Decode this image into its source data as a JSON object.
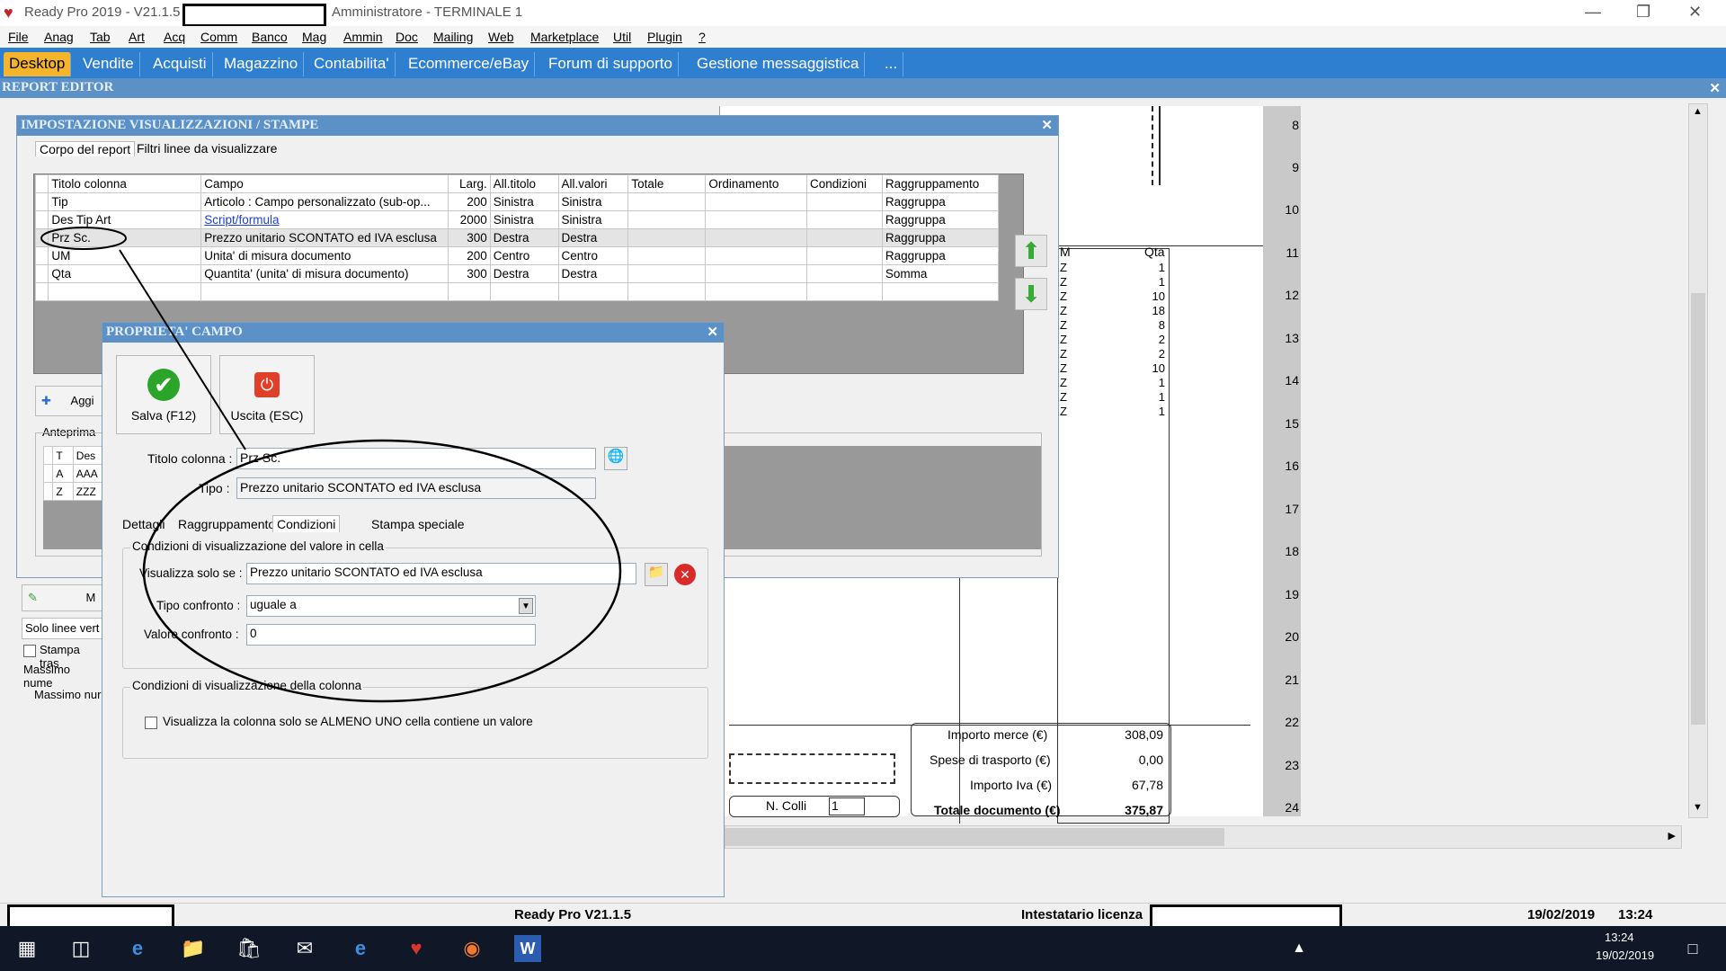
{
  "window": {
    "app_title": "Ready Pro 2019 - V21.1.5",
    "user_title": "Amministratore - TERMINALE 1"
  },
  "menu": [
    "File",
    "Anag",
    "Tab",
    "Art",
    "Acq",
    "Comm",
    "Banco",
    "Mag",
    "Ammin",
    "Doc",
    "Mailing",
    "Web",
    "Marketplace",
    "Util",
    "Plugin",
    "?"
  ],
  "tabs": [
    "Desktop",
    "Vendite",
    "Acquisti",
    "Magazzino",
    "Contabilita'",
    "Ecommerce/eBay",
    "Forum di supporto",
    "Gestione messaggistica",
    "..."
  ],
  "report_editor": {
    "title": "REPORT EDITOR"
  },
  "imp_dialog": {
    "title": "IMPOSTAZIONE VISUALIZZAZIONI / STAMPE",
    "tabs": [
      "Corpo del report",
      "Filtri linee da visualizzare"
    ],
    "columns": [
      "Titolo colonna",
      "Campo",
      "Larg.",
      "All.titolo",
      "All.valori",
      "Totale",
      "Ordinamento",
      "Condizioni",
      "Raggruppamento"
    ],
    "rows": [
      [
        "Tip",
        "Articolo : Campo personalizzato (sub-op...",
        "200",
        "Sinistra",
        "Sinistra",
        "",
        "",
        "",
        "Raggruppa"
      ],
      [
        "Des Tip Art",
        "Script/formula",
        "2000",
        "Sinistra",
        "Sinistra",
        "",
        "",
        "",
        "Raggruppa"
      ],
      [
        "Prz Sc.",
        "Prezzo unitario SCONTATO ed IVA esclusa",
        "300",
        "Destra",
        "Destra",
        "",
        "",
        "",
        "Raggruppa"
      ],
      [
        "UM",
        "Unita' di misura documento",
        "200",
        "Centro",
        "Centro",
        "",
        "",
        "",
        "Raggruppa"
      ],
      [
        "Qta",
        "Quantita' (unita' di misura documento)",
        "300",
        "Destra",
        "Destra",
        "",
        "",
        "",
        "Somma"
      ]
    ],
    "add_label": "Aggi",
    "preview_label": "Anteprima",
    "preview_rows": [
      [
        "T",
        "Des"
      ],
      [
        "A",
        "AAA"
      ],
      [
        "Z",
        "ZZZ"
      ]
    ],
    "side_labels": [
      "Solo linee vert",
      "Stampa tras",
      "Massimo nume",
      "Massimo nur"
    ],
    "side_button": "M"
  },
  "prop_dialog": {
    "title": "PROPRIETA' CAMPO",
    "save_label": "Salva (F12)",
    "exit_label": "Uscita (ESC)",
    "titolo_label": "Titolo colonna :",
    "titolo_value": "Prz Sc.",
    "tipo_label": "Tipo :",
    "tipo_value": "Prezzo unitario SCONTATO ed IVA esclusa",
    "tabs": [
      "Dettagli",
      "Raggruppamento",
      "Condizioni",
      "Stampa speciale"
    ],
    "group1_title": "Condizioni di visualizzazione del valore in cella",
    "vis_label": "Visualizza solo se :",
    "vis_value": "Prezzo unitario SCONTATO ed IVA esclusa",
    "tipo_conf_label": "Tipo confronto :",
    "tipo_conf_value": "uguale a",
    "val_conf_label": "Valore confronto :",
    "val_conf_value": "0",
    "group2_title": "Condizioni di visualizzazione della colonna",
    "checkbox_label": "Visualizza la colonna solo se ALMENO UNO cella contiene un valore"
  },
  "document": {
    "col_m": "M",
    "col_qta": "Qta",
    "z_values": [
      "Z",
      "Z",
      "Z",
      "Z",
      "Z",
      "Z",
      "Z",
      "Z",
      "Z",
      "Z",
      "Z"
    ],
    "qta_values": [
      "1",
      "1",
      "10",
      "18",
      "8",
      "2",
      "2",
      "10",
      "1",
      "1",
      "1"
    ],
    "totals": [
      {
        "label": "Importo merce (€)",
        "value": "308,09"
      },
      {
        "label": "Spese di trasporto (€)",
        "value": "0,00"
      },
      {
        "label": "Importo Iva (€)",
        "value": "67,78"
      },
      {
        "label": "Totale documento (€)",
        "value": "375,87"
      }
    ],
    "colli_label": "N. Colli",
    "colli_value": "1"
  },
  "ruler": [
    "8",
    "9",
    "10",
    "11",
    "12",
    "13",
    "14",
    "15",
    "16",
    "17",
    "18",
    "19",
    "20",
    "21",
    "22",
    "23",
    "24"
  ],
  "status": {
    "version": "Ready Pro V21.1.5",
    "license_label": "Intestatario licenza",
    "date": "19/02/2019",
    "time": "13:24"
  },
  "taskbar": {
    "time": "13:24",
    "date": "19/02/2019"
  }
}
